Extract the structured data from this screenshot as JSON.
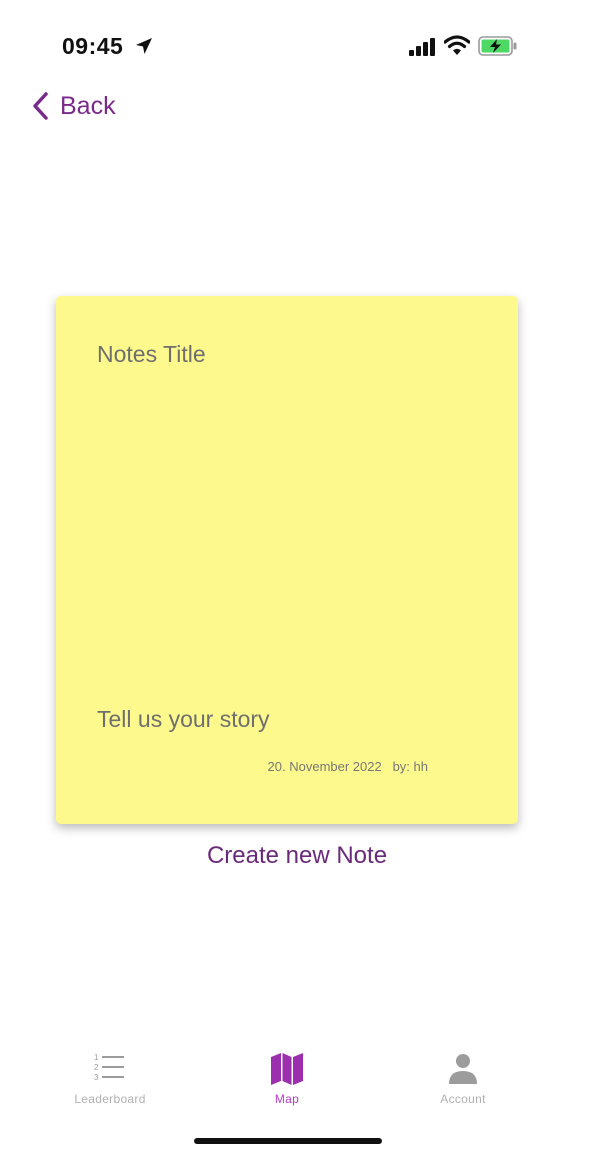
{
  "status_bar": {
    "time": "09:45",
    "icons": [
      "location-arrow-icon",
      "signal-icon",
      "wifi-icon",
      "battery-charging-icon"
    ]
  },
  "nav": {
    "back_label": "Back"
  },
  "note": {
    "title_placeholder": "Notes Title",
    "body_placeholder": "Tell us your story",
    "date": "20. November 2022",
    "author": "by: hh"
  },
  "create_label": "Create new Note",
  "tabs": [
    {
      "label": "Leaderboard",
      "icon": "list-numbered-icon",
      "active": false
    },
    {
      "label": "Map",
      "icon": "map-icon",
      "active": true
    },
    {
      "label": "Account",
      "icon": "person-icon",
      "active": false
    }
  ],
  "colors": {
    "accent": "#7a2a8a",
    "tab_active": "#b53cc8",
    "note_background": "#fdf98d",
    "battery_green": "#4cd964"
  }
}
